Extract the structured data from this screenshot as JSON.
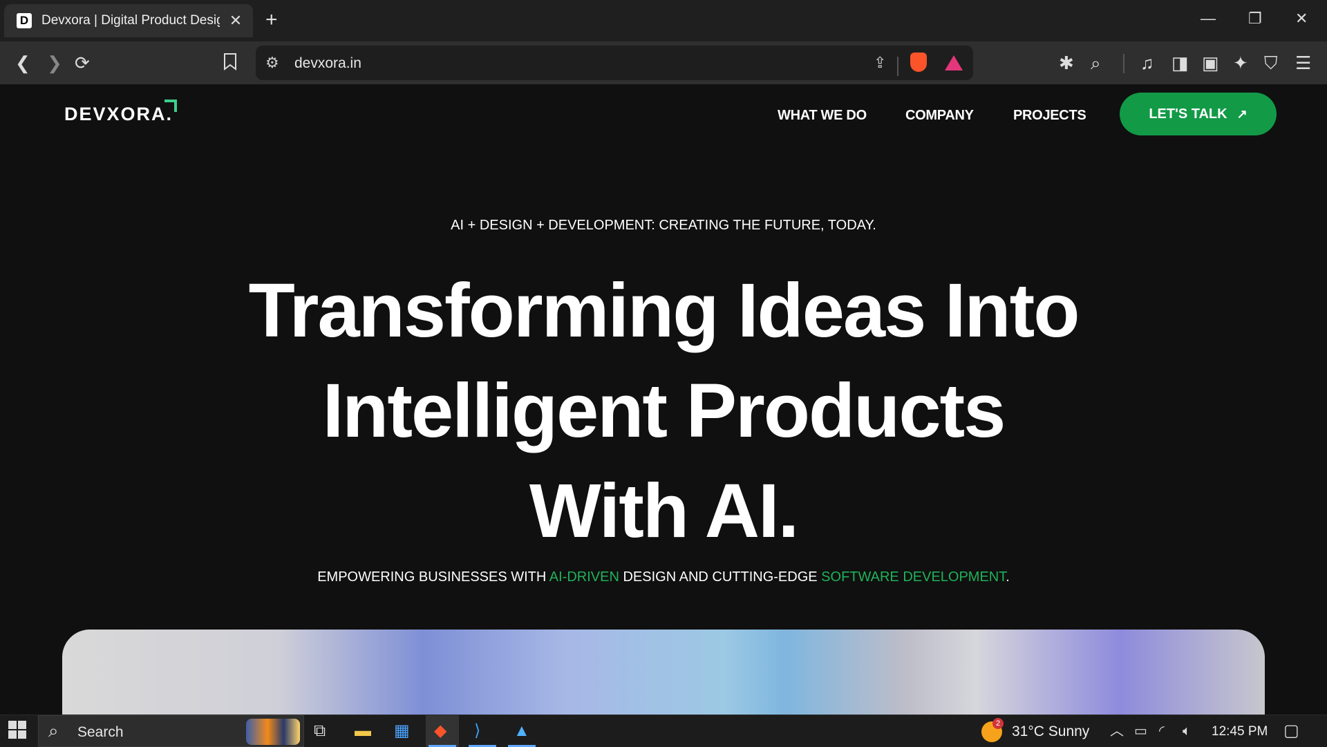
{
  "browser": {
    "tab": {
      "favicon": "D",
      "title": "Devxora | Digital Product Design",
      "close": "✕"
    },
    "new_tab": "+",
    "window": {
      "minimize": "—",
      "restore": "❐",
      "close": "✕"
    },
    "url": "devxora.in"
  },
  "site": {
    "logo": "DEVXORA.",
    "nav": [
      "WHAT WE DO",
      "COMPANY",
      "PROJECTS"
    ],
    "cta": "LET'S TALK",
    "cta_arrow": "↗",
    "eyebrow": "AI + DESIGN + DEVELOPMENT: CREATING THE FUTURE, TODAY.",
    "hero_lines": [
      "Transforming Ideas Into",
      "Intelligent Products",
      "With AI."
    ],
    "sub": {
      "part1": "EMPOWERING BUSINESSES WITH ",
      "accent1": "AI-DRIVEN",
      "part2": " DESIGN AND CUTTING-EDGE ",
      "accent2": "SOFTWARE DEVELOPMENT",
      "part3": "."
    },
    "accent_color": "#129a47"
  },
  "taskbar": {
    "search_placeholder": "Search",
    "weather_badge": "2",
    "weather": "31°C  Sunny",
    "time": "12:45 PM"
  }
}
